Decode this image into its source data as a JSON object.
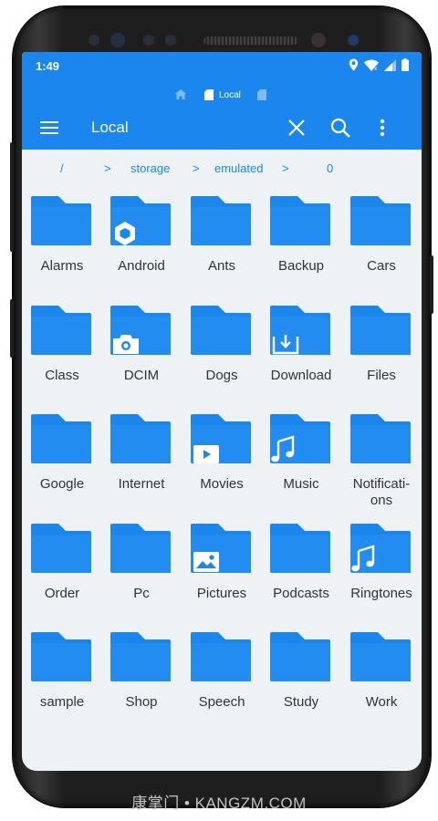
{
  "status_bar": {
    "time": "1:49"
  },
  "tabs": {
    "active_label": "Local"
  },
  "toolbar": {
    "title": "Local"
  },
  "path": {
    "root": "/",
    "segments": [
      "storage",
      "emulated",
      "0"
    ]
  },
  "folders": [
    {
      "label": "Alarms",
      "badge": ""
    },
    {
      "label": "Android",
      "badge": "android"
    },
    {
      "label": "Ants",
      "badge": ""
    },
    {
      "label": "Backup",
      "badge": ""
    },
    {
      "label": "Cars",
      "badge": ""
    },
    {
      "label": "Class",
      "badge": ""
    },
    {
      "label": "DCIM",
      "badge": "camera"
    },
    {
      "label": "Dogs",
      "badge": ""
    },
    {
      "label": "Download",
      "badge": "download"
    },
    {
      "label": "Files",
      "badge": ""
    },
    {
      "label": "Google",
      "badge": ""
    },
    {
      "label": "Internet",
      "badge": ""
    },
    {
      "label": "Movies",
      "badge": "play"
    },
    {
      "label": "Music",
      "badge": "music"
    },
    {
      "label": "Notificati-\nons",
      "badge": ""
    },
    {
      "label": "Order",
      "badge": ""
    },
    {
      "label": "Pc",
      "badge": ""
    },
    {
      "label": "Pictures",
      "badge": "picture"
    },
    {
      "label": "Podcasts",
      "badge": ""
    },
    {
      "label": "Ringtones",
      "badge": "music"
    },
    {
      "label": "sample",
      "badge": ""
    },
    {
      "label": "Shop",
      "badge": ""
    },
    {
      "label": "Speech",
      "badge": ""
    },
    {
      "label": "Study",
      "badge": ""
    },
    {
      "label": "Work",
      "badge": ""
    }
  ],
  "watermark": "康掌门 • KANGZM.COM",
  "colors": {
    "accent": "#1a86ee",
    "background": "#eff2f5"
  }
}
